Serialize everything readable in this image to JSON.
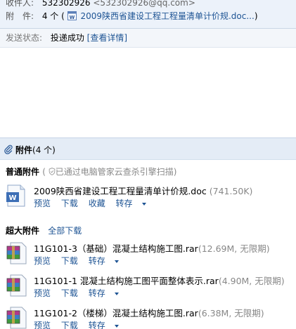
{
  "header": {
    "recipient_label": "收件人:",
    "recipient_name": "532302926",
    "recipient_email": "<532302926@qq.com>",
    "attachment_label": "附　件:",
    "attachment_count": "4 个",
    "attachment_preview": "2009陕西省建设工程工程量清单计价规.doc..."
  },
  "status": {
    "label": "发送状态:",
    "value": "投递成功",
    "details_link": "[查看详情]"
  },
  "attachments": {
    "title": "附件",
    "count": "(4 个)",
    "normal_section": {
      "title": "普通附件",
      "note": "已通过电脑管家云查杀引擎扫描",
      "files": [
        {
          "name": "2009陕西省建设工程工程量清单计价规.doc",
          "size": "(741.50K)",
          "actions": [
            "预览",
            "下载",
            "收藏",
            "转存"
          ]
        }
      ]
    },
    "large_section": {
      "title": "超大附件",
      "download_all": "全部下载",
      "files": [
        {
          "name": "11G101-3（基础）混凝土结构施工图.rar",
          "size": "(12.69M, 无限期)",
          "actions": [
            "预览",
            "下载",
            "转存"
          ]
        },
        {
          "name": "11G101-1 混凝土结构施工图平面整体表示.rar",
          "size": "(4.90M, 无限期)",
          "actions": [
            "预览",
            "下载",
            "转存"
          ]
        },
        {
          "name": "11G101-2（楼梯）混凝土结构施工图.rar",
          "size": "(6.38M, 无限期)",
          "actions": [
            "预览",
            "下载",
            "转存"
          ]
        }
      ]
    }
  },
  "colors": {
    "link": "#1e5494",
    "header_bg": "#ecf2fa",
    "section_bg": "#e4ecf6"
  }
}
